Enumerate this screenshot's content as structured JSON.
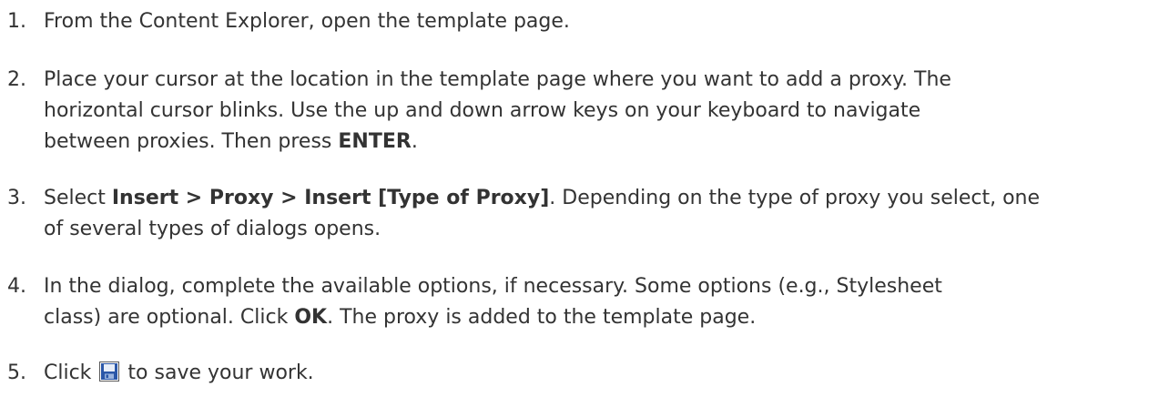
{
  "steps": [
    {
      "number": "1.",
      "lines": [
        [
          {
            "t": "From the Content Explorer, open the template page."
          }
        ]
      ]
    },
    {
      "number": "2.",
      "lines": [
        [
          {
            "t": "Place your cursor at the location in the template page where you want to add a proxy. The"
          }
        ],
        [
          {
            "t": "horizontal cursor blinks. Use the up and down arrow keys on your keyboard to navigate"
          }
        ],
        [
          {
            "t": "between proxies. Then press "
          },
          {
            "t": "ENTER",
            "bold": true
          },
          {
            "t": "."
          }
        ]
      ]
    },
    {
      "number": "3.",
      "lines": [
        [
          {
            "t": "Select "
          },
          {
            "t": "Insert > Proxy > Insert [Type of Proxy]",
            "bold": true
          },
          {
            "t": ". Depending on the type of proxy you select, one"
          }
        ],
        [
          {
            "t": "of several types of dialogs opens."
          }
        ]
      ]
    },
    {
      "number": "4.",
      "lines": [
        [
          {
            "t": "In the dialog, complete the available options, if necessary. Some options (e.g., Stylesheet"
          }
        ],
        [
          {
            "t": "class) are optional. Click "
          },
          {
            "t": "OK",
            "bold": true
          },
          {
            "t": ". The proxy is added to the template page."
          }
        ]
      ]
    },
    {
      "number": "5.",
      "lines": [
        [
          {
            "t": "Click "
          },
          {
            "icon": "save-icon"
          },
          {
            "t": " to save your work."
          }
        ]
      ]
    }
  ],
  "colors": {
    "text": "#333333",
    "icon_blue": "#2b57a8",
    "icon_frame": "#5a5a5a"
  }
}
